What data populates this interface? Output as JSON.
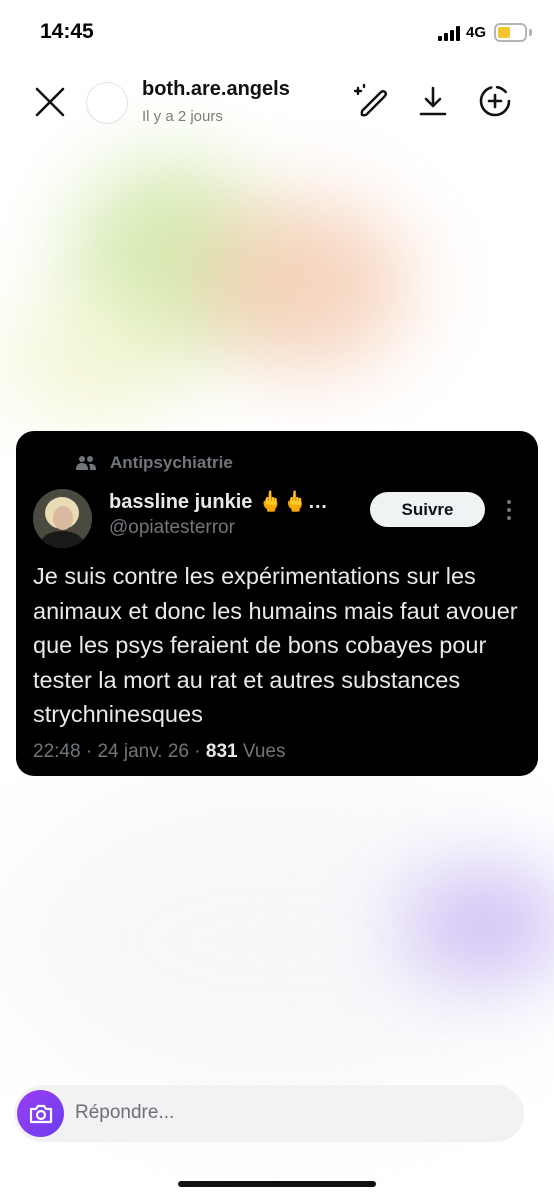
{
  "status_bar": {
    "time": "14:45",
    "network": "4G",
    "battery_level": 0.4,
    "battery_color": "#f5c431"
  },
  "story_header": {
    "close_icon": "close-icon",
    "username": "both.are.angels",
    "time_ago": "Il y a 2 jours",
    "actions": [
      "draw-icon",
      "download-icon",
      "add-to-story-icon"
    ]
  },
  "tweet": {
    "community_icon": "community-icon",
    "community": "Antipsychiatrie",
    "display_name": "bassline junkie 🖕🖕…",
    "handle": "@opiatesterror",
    "follow_label": "Suivre",
    "more_icon": "more-vertical-icon",
    "text": "Je suis contre les expérimentations sur les animaux et donc les humains mais faut avouer que les psys feraient de bons cobayes pour tester la mort au rat et autres substances strychninesques",
    "time": "22:48",
    "separator": "·",
    "date": "24 janv. 26",
    "views_count": "831",
    "views_label": "Vues"
  },
  "reply": {
    "camera_icon": "camera-icon",
    "placeholder": "Répondre..."
  },
  "colors": {
    "card_background": "#000000",
    "card_text": "#e7e9ea",
    "muted_text": "#71767b",
    "camera_gradient_start": "#9b3df2",
    "camera_gradient_end": "#6a3ef0"
  }
}
